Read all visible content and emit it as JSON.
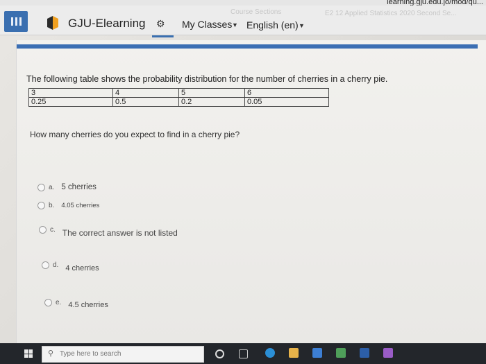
{
  "url_fragment": "learning.gju.edu.jo/mod/qu...",
  "header": {
    "site_title": "GJU-Elearning",
    "my_classes": "My Classes",
    "language": "English (en)",
    "ghost_course": "Course Sections",
    "ghost_course_name": "E2 12 Applied Statistics 2020 Second Se..."
  },
  "question": {
    "text": "The following table shows the probability distribution for the number of cherries in a cherry pie.",
    "table": {
      "x": [
        "3",
        "4",
        "5",
        "6"
      ],
      "p": [
        "0.25",
        "0.5",
        "0.2",
        "0.05"
      ]
    },
    "ask": "How many cherries do you expect to find in a cherry pie?",
    "options": [
      {
        "letter": "a.",
        "label": "5 cherries"
      },
      {
        "letter": "b.",
        "label": "4.05 cherries"
      },
      {
        "letter": "c.",
        "label": "The correct answer is not listed"
      },
      {
        "letter": "d.",
        "label": "4 cherries"
      },
      {
        "letter": "e.",
        "label": "4.5 cherries"
      }
    ]
  },
  "taskbar": {
    "search_placeholder": "Type here to search"
  },
  "colors": {
    "accent": "#3b6eb3",
    "taskbar": "#23262b"
  }
}
